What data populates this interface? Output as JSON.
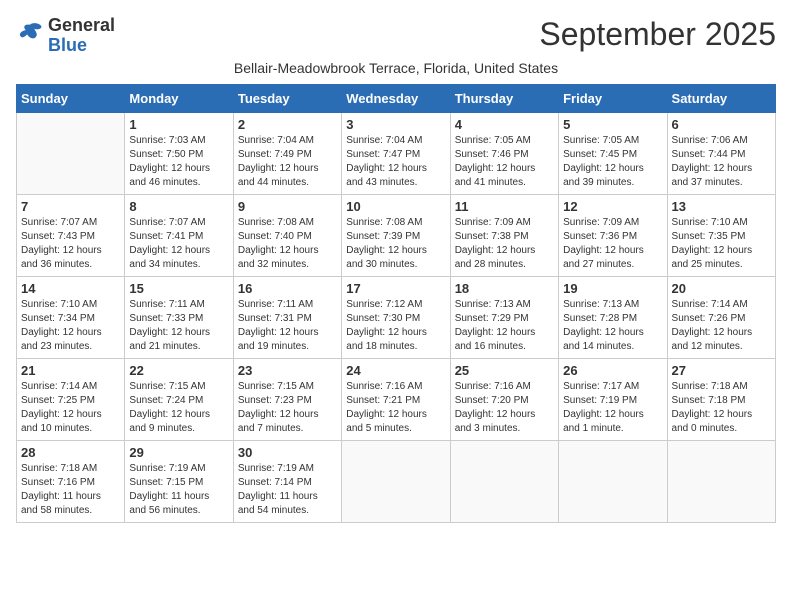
{
  "header": {
    "logo_general": "General",
    "logo_blue": "Blue",
    "month_title": "September 2025",
    "subtitle": "Bellair-Meadowbrook Terrace, Florida, United States"
  },
  "days_of_week": [
    "Sunday",
    "Monday",
    "Tuesday",
    "Wednesday",
    "Thursday",
    "Friday",
    "Saturday"
  ],
  "weeks": [
    [
      {
        "day": "",
        "info": ""
      },
      {
        "day": "1",
        "info": "Sunrise: 7:03 AM\nSunset: 7:50 PM\nDaylight: 12 hours\nand 46 minutes."
      },
      {
        "day": "2",
        "info": "Sunrise: 7:04 AM\nSunset: 7:49 PM\nDaylight: 12 hours\nand 44 minutes."
      },
      {
        "day": "3",
        "info": "Sunrise: 7:04 AM\nSunset: 7:47 PM\nDaylight: 12 hours\nand 43 minutes."
      },
      {
        "day": "4",
        "info": "Sunrise: 7:05 AM\nSunset: 7:46 PM\nDaylight: 12 hours\nand 41 minutes."
      },
      {
        "day": "5",
        "info": "Sunrise: 7:05 AM\nSunset: 7:45 PM\nDaylight: 12 hours\nand 39 minutes."
      },
      {
        "day": "6",
        "info": "Sunrise: 7:06 AM\nSunset: 7:44 PM\nDaylight: 12 hours\nand 37 minutes."
      }
    ],
    [
      {
        "day": "7",
        "info": "Sunrise: 7:07 AM\nSunset: 7:43 PM\nDaylight: 12 hours\nand 36 minutes."
      },
      {
        "day": "8",
        "info": "Sunrise: 7:07 AM\nSunset: 7:41 PM\nDaylight: 12 hours\nand 34 minutes."
      },
      {
        "day": "9",
        "info": "Sunrise: 7:08 AM\nSunset: 7:40 PM\nDaylight: 12 hours\nand 32 minutes."
      },
      {
        "day": "10",
        "info": "Sunrise: 7:08 AM\nSunset: 7:39 PM\nDaylight: 12 hours\nand 30 minutes."
      },
      {
        "day": "11",
        "info": "Sunrise: 7:09 AM\nSunset: 7:38 PM\nDaylight: 12 hours\nand 28 minutes."
      },
      {
        "day": "12",
        "info": "Sunrise: 7:09 AM\nSunset: 7:36 PM\nDaylight: 12 hours\nand 27 minutes."
      },
      {
        "day": "13",
        "info": "Sunrise: 7:10 AM\nSunset: 7:35 PM\nDaylight: 12 hours\nand 25 minutes."
      }
    ],
    [
      {
        "day": "14",
        "info": "Sunrise: 7:10 AM\nSunset: 7:34 PM\nDaylight: 12 hours\nand 23 minutes."
      },
      {
        "day": "15",
        "info": "Sunrise: 7:11 AM\nSunset: 7:33 PM\nDaylight: 12 hours\nand 21 minutes."
      },
      {
        "day": "16",
        "info": "Sunrise: 7:11 AM\nSunset: 7:31 PM\nDaylight: 12 hours\nand 19 minutes."
      },
      {
        "day": "17",
        "info": "Sunrise: 7:12 AM\nSunset: 7:30 PM\nDaylight: 12 hours\nand 18 minutes."
      },
      {
        "day": "18",
        "info": "Sunrise: 7:13 AM\nSunset: 7:29 PM\nDaylight: 12 hours\nand 16 minutes."
      },
      {
        "day": "19",
        "info": "Sunrise: 7:13 AM\nSunset: 7:28 PM\nDaylight: 12 hours\nand 14 minutes."
      },
      {
        "day": "20",
        "info": "Sunrise: 7:14 AM\nSunset: 7:26 PM\nDaylight: 12 hours\nand 12 minutes."
      }
    ],
    [
      {
        "day": "21",
        "info": "Sunrise: 7:14 AM\nSunset: 7:25 PM\nDaylight: 12 hours\nand 10 minutes."
      },
      {
        "day": "22",
        "info": "Sunrise: 7:15 AM\nSunset: 7:24 PM\nDaylight: 12 hours\nand 9 minutes."
      },
      {
        "day": "23",
        "info": "Sunrise: 7:15 AM\nSunset: 7:23 PM\nDaylight: 12 hours\nand 7 minutes."
      },
      {
        "day": "24",
        "info": "Sunrise: 7:16 AM\nSunset: 7:21 PM\nDaylight: 12 hours\nand 5 minutes."
      },
      {
        "day": "25",
        "info": "Sunrise: 7:16 AM\nSunset: 7:20 PM\nDaylight: 12 hours\nand 3 minutes."
      },
      {
        "day": "26",
        "info": "Sunrise: 7:17 AM\nSunset: 7:19 PM\nDaylight: 12 hours\nand 1 minute."
      },
      {
        "day": "27",
        "info": "Sunrise: 7:18 AM\nSunset: 7:18 PM\nDaylight: 12 hours\nand 0 minutes."
      }
    ],
    [
      {
        "day": "28",
        "info": "Sunrise: 7:18 AM\nSunset: 7:16 PM\nDaylight: 11 hours\nand 58 minutes."
      },
      {
        "day": "29",
        "info": "Sunrise: 7:19 AM\nSunset: 7:15 PM\nDaylight: 11 hours\nand 56 minutes."
      },
      {
        "day": "30",
        "info": "Sunrise: 7:19 AM\nSunset: 7:14 PM\nDaylight: 11 hours\nand 54 minutes."
      },
      {
        "day": "",
        "info": ""
      },
      {
        "day": "",
        "info": ""
      },
      {
        "day": "",
        "info": ""
      },
      {
        "day": "",
        "info": ""
      }
    ]
  ]
}
